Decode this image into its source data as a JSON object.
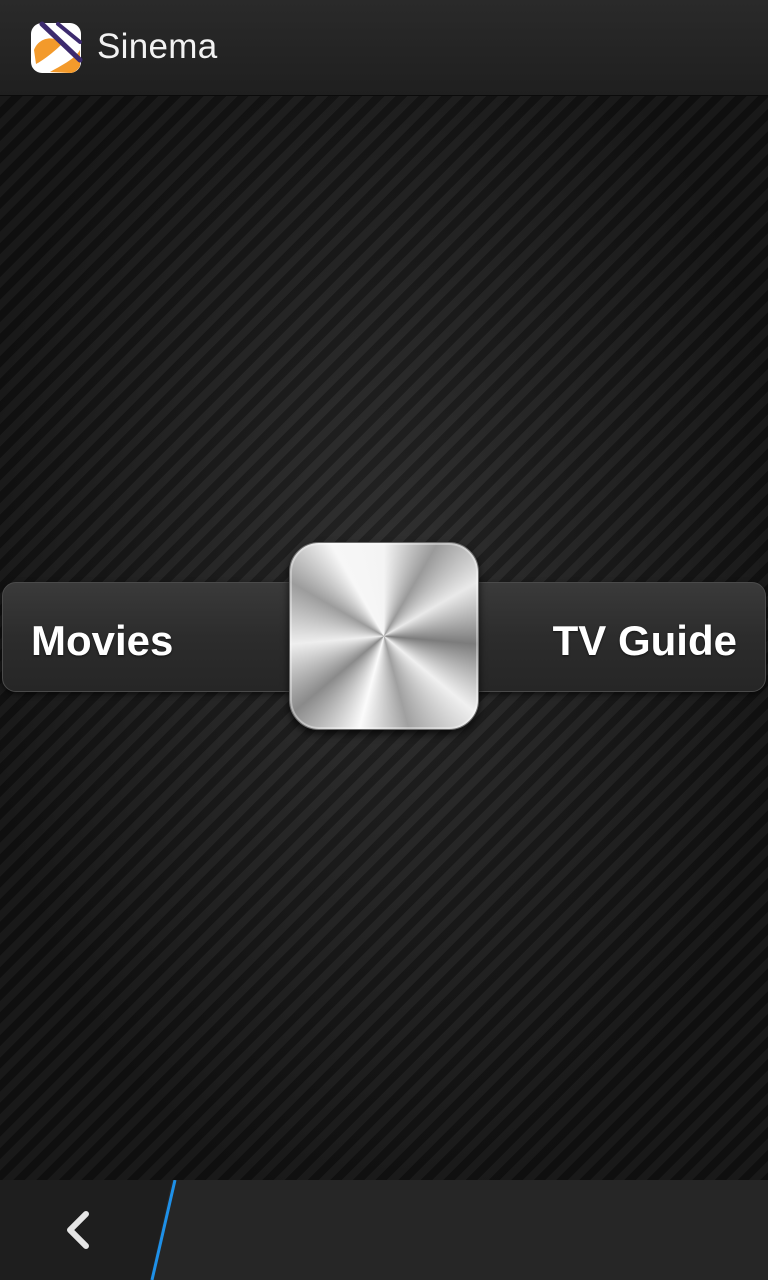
{
  "header": {
    "title": "Sinema",
    "icon": "sinema-logo-icon"
  },
  "main": {
    "movies_label": "Movies",
    "tvguide_label": "TV Guide",
    "center_button_icon": "brushed-metal-button"
  },
  "bottom_bar": {
    "back_icon": "chevron-left-icon"
  },
  "colors": {
    "accent": "#1e90e8",
    "logo_orange": "#f39a2b",
    "logo_purple": "#3c2a6e"
  }
}
